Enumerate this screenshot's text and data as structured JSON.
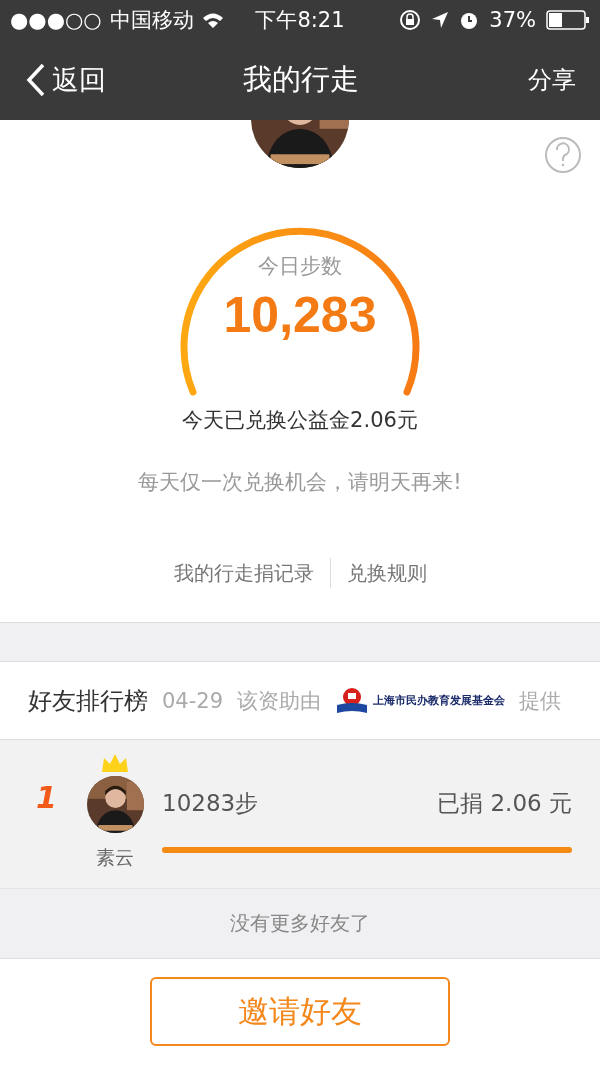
{
  "status_bar": {
    "signal_dots": "●●●○○",
    "carrier": "中国移动",
    "time": "下午8:21",
    "battery": "37%"
  },
  "nav": {
    "back": "返回",
    "title": "我的行走",
    "share": "分享"
  },
  "today": {
    "label": "今日步数",
    "steps": "10,283",
    "exchanged": "今天已兑换公益金2.06元",
    "note": "每天仅一次兑换机会，请明天再来!",
    "links": [
      "我的行走捐记录",
      "兑换规则"
    ]
  },
  "ranking": {
    "title": "好友排行榜",
    "date": "04-29",
    "sponsor_prefix": "该资助由",
    "sponsor_name": "上海市民办教育发展基金会",
    "sponsor_suffix": "提供",
    "rows": [
      {
        "rank": "1",
        "name": "素云",
        "steps": "10283步",
        "donated": "已捐 2.06 元",
        "level": 1,
        "crown": true
      }
    ],
    "footer": "没有更多好友了"
  },
  "invite_button": "邀请好友"
}
